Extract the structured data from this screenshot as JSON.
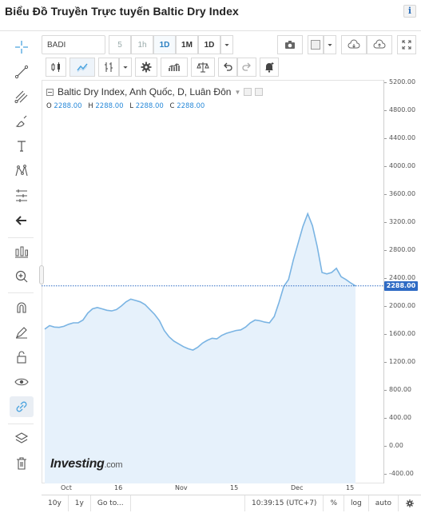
{
  "page": {
    "title": "Biểu Đồ Truyền Trực tuyến Baltic Dry Index",
    "info_icon": "i"
  },
  "toolbar": {
    "symbol": "BADI",
    "intervals": [
      "5",
      "1h",
      "1D",
      "1M",
      "1D"
    ],
    "icons": [
      "camera-icon",
      "color-swatch-icon",
      "cloud-download-icon",
      "cloud-upload-icon",
      "fullscreen-icon"
    ],
    "chart_tools": [
      "candles-icon",
      "line-style-icon",
      "indicator-icon",
      "settings-icon",
      "volume-icon",
      "compare-icon",
      "undo-icon",
      "redo-icon",
      "alert-icon"
    ]
  },
  "left_tools": [
    "crosshair-icon",
    "trend-line-icon",
    "fibonacci-icon",
    "brush-icon",
    "text-icon",
    "pattern-icon",
    "prediction-icon",
    "back-arrow-icon",
    "zoom-bars-icon",
    "zoom-in-icon",
    "magnet-icon",
    "lock-drawing-icon",
    "lock-icon",
    "eye-icon",
    "link-icon",
    "layers-icon",
    "trash-icon"
  ],
  "legend": {
    "title": "Baltic Dry Index, Anh Quốc, D, Luân Đôn",
    "ohlc": [
      {
        "label": "O",
        "value": "2288.00"
      },
      {
        "label": "H",
        "value": "2288.00"
      },
      {
        "label": "L",
        "value": "2288.00"
      },
      {
        "label": "C",
        "value": "2288.00"
      }
    ]
  },
  "last_price": "2288.00",
  "brand": {
    "name": "Investing",
    "suffix": ".com"
  },
  "bottom_bar": {
    "range_10y": "10y",
    "range_1y": "1y",
    "goto": "Go to...",
    "clock": "10:39:15 (UTC+7)",
    "percent": "%",
    "log": "log",
    "auto": "auto"
  },
  "colors": {
    "line": "#7ab4e3",
    "area": "#e6f1fb",
    "price_badge": "#2f6bc4",
    "accent": "#2a7fc1"
  },
  "chart_data": {
    "type": "area",
    "title": "Baltic Dry Index, Anh Quốc, D, Luân Đôn",
    "x_tick_labels": [
      "Oct",
      "16",
      "Nov",
      "15",
      "Dec",
      "15"
    ],
    "y_tick_labels": [
      "5200.00",
      "4800.00",
      "4400.00",
      "4000.00",
      "3600.00",
      "3200.00",
      "2800.00",
      "2400.00",
      "2000.00",
      "1600.00",
      "1200.00",
      "800.00",
      "400.00",
      "0.00",
      "-400.00"
    ],
    "ylim": [
      -400,
      5200
    ],
    "last_value": 2288,
    "series": [
      {
        "values": [
          1670,
          1720,
          1700,
          1695,
          1710,
          1740,
          1760,
          1760,
          1800,
          1900,
          1960,
          1980,
          1960,
          1940,
          1930,
          1950,
          2000,
          2060,
          2100,
          2080,
          2060,
          2020,
          1950,
          1880,
          1790,
          1650,
          1560,
          1500,
          1460,
          1420,
          1390,
          1370,
          1410,
          1470,
          1510,
          1540,
          1530,
          1580,
          1610,
          1630,
          1650,
          1660,
          1700,
          1760,
          1800,
          1790,
          1770,
          1760,
          1850,
          2050,
          2280,
          2380,
          2660,
          2900,
          3140,
          3320,
          3150,
          2850,
          2480,
          2460,
          2480,
          2540,
          2420,
          2380,
          2330,
          2288
        ]
      }
    ]
  }
}
